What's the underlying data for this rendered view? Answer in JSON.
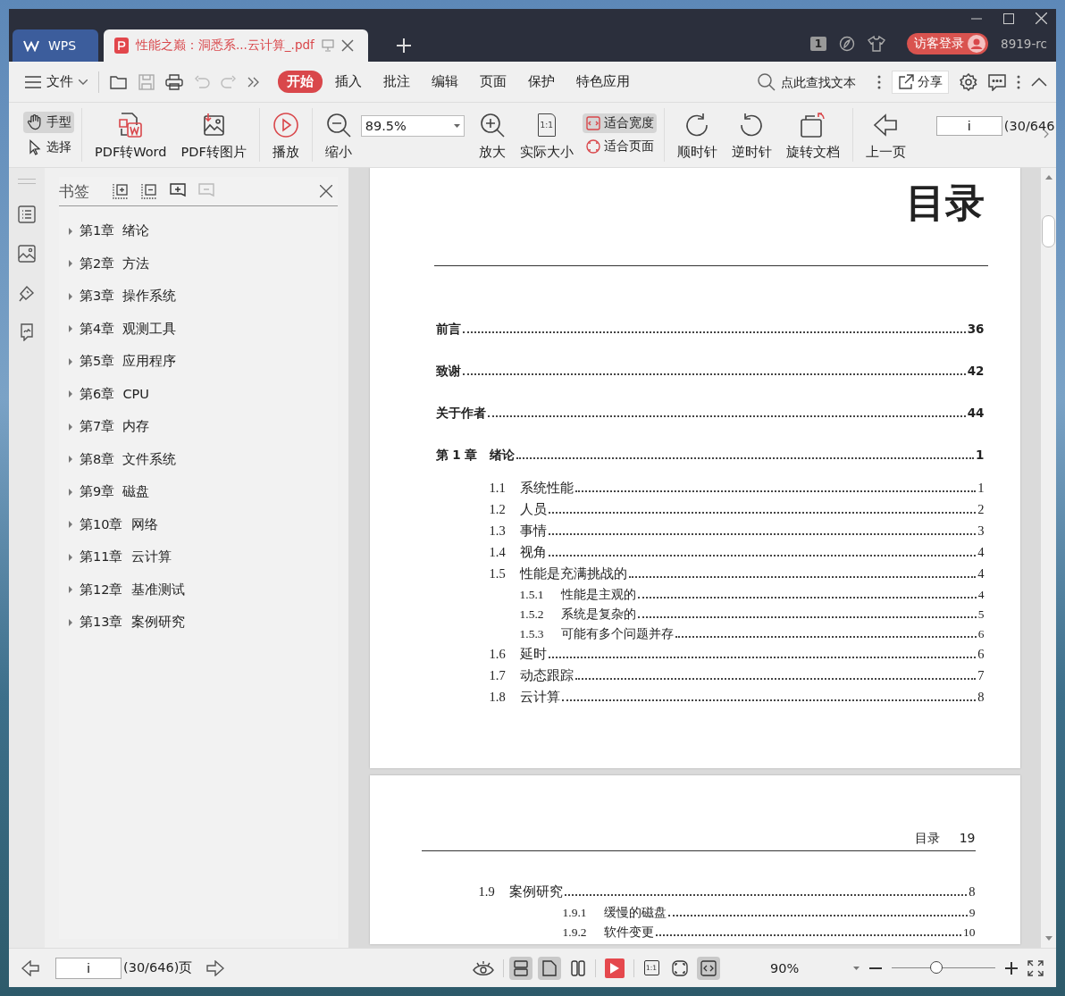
{
  "tabs": [
    {
      "label": "WPS",
      "kind": "home",
      "selected": false
    },
    {
      "label": "性能之巅：洞悉系...云计算_.pdf",
      "kind": "doc",
      "selected": true
    }
  ],
  "titlebar": {
    "badge": "1",
    "login": "访客登录",
    "user": "8919-rc"
  },
  "menu": {
    "file": "文件",
    "search_placeholder": "点此查找文本",
    "share": "分享",
    "tabs": [
      {
        "label": "开始",
        "selected": true
      },
      {
        "label": "插入",
        "selected": false
      },
      {
        "label": "批注",
        "selected": false
      },
      {
        "label": "编辑",
        "selected": false
      },
      {
        "label": "页面",
        "selected": false
      },
      {
        "label": "保护",
        "selected": false
      },
      {
        "label": "特色应用",
        "selected": false
      }
    ]
  },
  "toolbar": [
    {
      "kind": "pair",
      "items": [
        {
          "label": "手型",
          "selected": true
        },
        {
          "label": "选择",
          "selected": false
        }
      ]
    },
    {
      "kind": "big",
      "label": "PDF转Word"
    },
    {
      "kind": "big",
      "label": "PDF转图片"
    },
    {
      "kind": "big",
      "label": "播放"
    },
    {
      "kind": "big",
      "label": "缩小"
    },
    {
      "kind": "zoom",
      "value": "89.5%"
    },
    {
      "kind": "big",
      "label": "放大"
    },
    {
      "kind": "big",
      "label": "实际大小",
      "icon_text": "1:1"
    },
    {
      "kind": "pair",
      "items": [
        {
          "label": "适合宽度",
          "selected": true
        },
        {
          "label": "适合页面",
          "selected": false
        }
      ]
    },
    {
      "kind": "big",
      "label": "顺时针"
    },
    {
      "kind": "big",
      "label": "逆时针"
    },
    {
      "kind": "big",
      "label": "旋转文档"
    },
    {
      "kind": "big",
      "label": "上一页"
    },
    {
      "kind": "page",
      "value": "i",
      "total": "(30/646"
    }
  ],
  "sidebar": {
    "title": "书签",
    "items": [
      {
        "label": "第1章  绪论",
        "expanded": false
      },
      {
        "label": "第2章  方法",
        "expanded": false
      },
      {
        "label": "第3章  操作系统",
        "expanded": false
      },
      {
        "label": "第4章  观测工具",
        "expanded": false
      },
      {
        "label": "第5章  应用程序",
        "expanded": false
      },
      {
        "label": "第6章  CPU",
        "expanded": false
      },
      {
        "label": "第7章  内存",
        "expanded": false
      },
      {
        "label": "第8章  文件系统",
        "expanded": false
      },
      {
        "label": "第9章  磁盘",
        "expanded": false
      },
      {
        "label": "第10章  网络",
        "expanded": false
      },
      {
        "label": "第11章  云计算",
        "expanded": false
      },
      {
        "label": "第12章  基准测试",
        "expanded": false
      },
      {
        "label": "第13章  案例研究",
        "expanded": false
      }
    ]
  },
  "pages": [
    {
      "title": "目录",
      "entries": [
        {
          "kind": "front",
          "title": "前言",
          "page": "36"
        },
        {
          "kind": "front",
          "title": "致谢",
          "page": "42"
        },
        {
          "kind": "front",
          "title": "关于作者",
          "page": "44"
        },
        {
          "kind": "chapter",
          "number": "第 1 章",
          "title": "绪论",
          "page": "1"
        },
        {
          "kind": "section",
          "number": "1.1",
          "title": "系统性能",
          "page": "1"
        },
        {
          "kind": "section",
          "number": "1.2",
          "title": "人员",
          "page": "2"
        },
        {
          "kind": "section",
          "number": "1.3",
          "title": "事情",
          "page": "3"
        },
        {
          "kind": "section",
          "number": "1.4",
          "title": "视角",
          "page": "4"
        },
        {
          "kind": "section",
          "number": "1.5",
          "title": "性能是充满挑战的",
          "page": "4"
        },
        {
          "kind": "subsection",
          "number": "1.5.1",
          "title": "性能是主观的",
          "page": "4"
        },
        {
          "kind": "subsection",
          "number": "1.5.2",
          "title": "系统是复杂的",
          "page": "5"
        },
        {
          "kind": "subsection",
          "number": "1.5.3",
          "title": "可能有多个问题并存",
          "page": "6"
        },
        {
          "kind": "section",
          "number": "1.6",
          "title": "延时",
          "page": "6"
        },
        {
          "kind": "section",
          "number": "1.7",
          "title": "动态跟踪",
          "page": "7"
        },
        {
          "kind": "section",
          "number": "1.8",
          "title": "云计算",
          "page": "8"
        }
      ]
    },
    {
      "header": "目录",
      "header_page": "19",
      "entries": [
        {
          "kind": "section",
          "number": "1.9",
          "title": "案例研究",
          "page": "8"
        },
        {
          "kind": "subsection",
          "number": "1.9.1",
          "title": "缓慢的磁盘",
          "page": "9"
        },
        {
          "kind": "subsection",
          "number": "1.9.2",
          "title": "软件变更",
          "page": "10"
        }
      ]
    }
  ],
  "status_bar": {
    "page_value": "i",
    "page_total": "(30/646)页",
    "zoom": "90%",
    "view_modes": [
      {
        "selected": true
      },
      {
        "selected": true
      },
      {
        "selected": false
      }
    ],
    "fit_modes": [
      {
        "icon_text": "1:1",
        "selected": false
      },
      {
        "selected": false
      },
      {
        "selected": true
      }
    ],
    "zoom_slider": {
      "level": 0.43
    }
  }
}
